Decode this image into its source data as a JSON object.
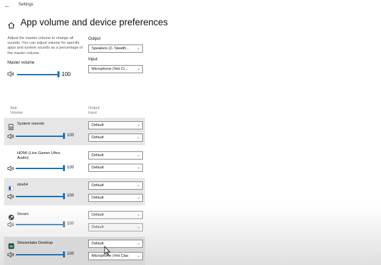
{
  "window": {
    "title": "Settings",
    "back_glyph": "←"
  },
  "page": {
    "title": "App volume and device preferences"
  },
  "master": {
    "description": "Adjust the master volume to change all sounds. You can adjust volume for specific apps and system sounds as a percentage of the master volume.",
    "label": "Master volume",
    "value": "100"
  },
  "device": {
    "output_label": "Output",
    "output_value": "Speakers (2- Stealth...",
    "input_label": "Input",
    "input_value": "Microphone (Yeti Cl..."
  },
  "headers": {
    "app": "App",
    "volume": "Volume",
    "output": "Output",
    "input": "Input"
  },
  "apps": [
    {
      "name": "System sounds",
      "volume": "100",
      "output": "Default",
      "input": "Default"
    },
    {
      "name": "HDMI (Live Gamer Ultra-Audio)",
      "volume": "100",
      "output": "Default",
      "input": "Default"
    },
    {
      "name": "obs64",
      "volume": "100",
      "output": "Default",
      "input": "Default"
    },
    {
      "name": "Steam",
      "volume": "100",
      "output": "Default",
      "input": "Default"
    },
    {
      "name": "Streamlabs Desktop",
      "volume": "100",
      "output": "Default",
      "input": "Microphone (Yeti Clas"
    }
  ],
  "colors": {
    "accent": "#1a73b8",
    "row_shade": "#e6e6e6"
  },
  "icons": {
    "back": "back-arrow-icon",
    "home": "home-icon",
    "speaker": "speaker-icon",
    "chevron": "chevron-down-icon"
  }
}
